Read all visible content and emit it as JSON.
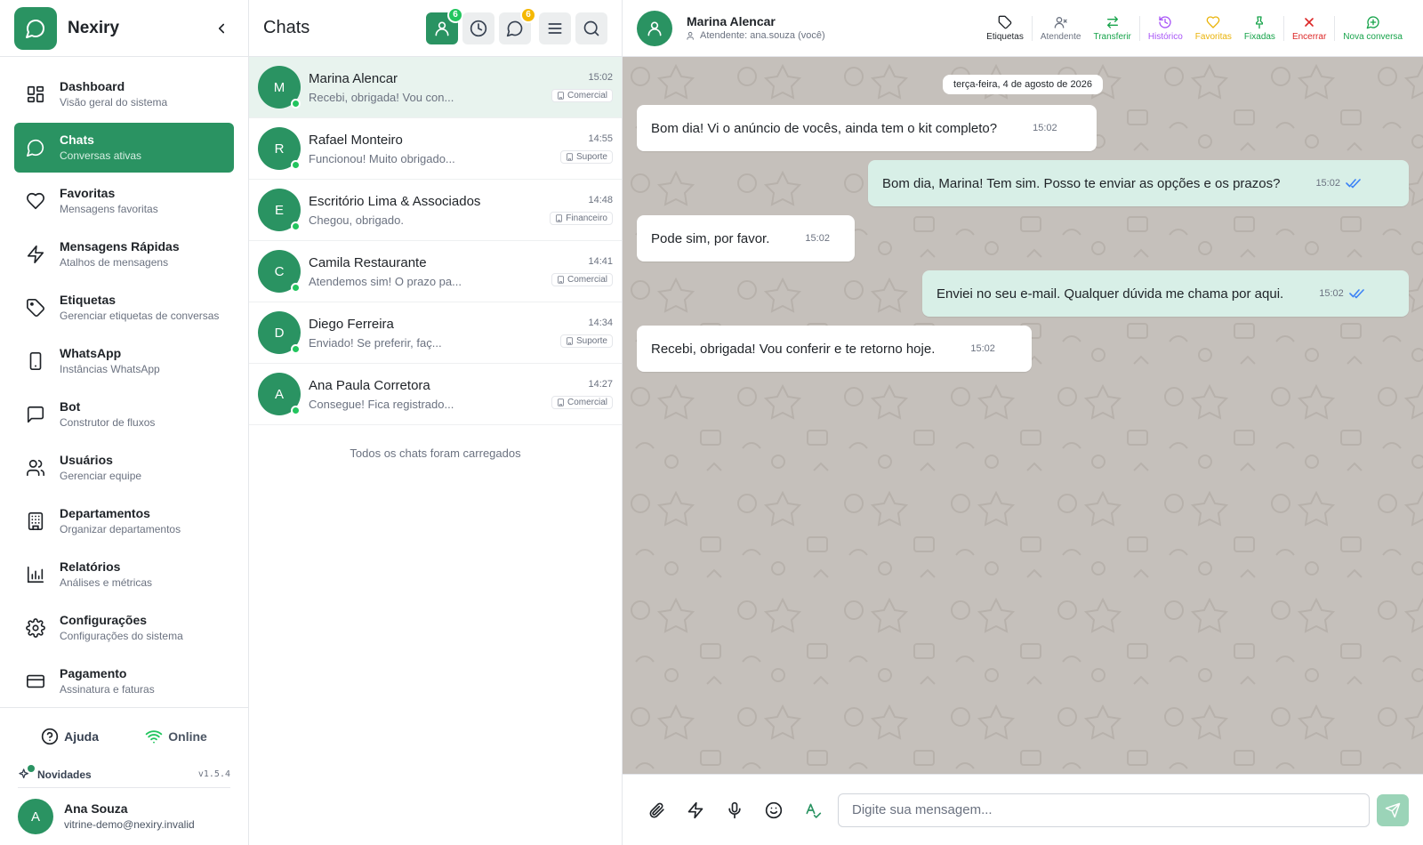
{
  "app": {
    "name": "Nexiry"
  },
  "sidebar": {
    "items": [
      {
        "label": "Dashboard",
        "sub": "Visão geral do sistema",
        "icon": "dashboard-icon"
      },
      {
        "label": "Chats",
        "sub": "Conversas ativas",
        "icon": "chat-icon"
      },
      {
        "label": "Favoritas",
        "sub": "Mensagens favoritas",
        "icon": "heart-icon"
      },
      {
        "label": "Mensagens Rápidas",
        "sub": "Atalhos de mensagens",
        "icon": "bolt-icon"
      },
      {
        "label": "Etiquetas",
        "sub": "Gerenciar etiquetas de conversas",
        "icon": "tag-icon"
      },
      {
        "label": "WhatsApp",
        "sub": "Instâncias WhatsApp",
        "icon": "phone-icon"
      },
      {
        "label": "Bot",
        "sub": "Construtor de fluxos",
        "icon": "bot-icon"
      },
      {
        "label": "Usuários",
        "sub": "Gerenciar equipe",
        "icon": "users-icon"
      },
      {
        "label": "Departamentos",
        "sub": "Organizar departamentos",
        "icon": "building-icon"
      },
      {
        "label": "Relatórios",
        "sub": "Análises e métricas",
        "icon": "chart-icon"
      },
      {
        "label": "Configurações",
        "sub": "Configurações do sistema",
        "icon": "gear-icon"
      },
      {
        "label": "Pagamento",
        "sub": "Assinatura e faturas",
        "icon": "card-icon"
      }
    ],
    "help_label": "Ajuda",
    "online_label": "Online",
    "news_label": "Novidades",
    "version": "v1.5.4",
    "user": {
      "initial": "A",
      "name": "Ana Souza",
      "email": "vitrine-demo@nexiry.invalid"
    }
  },
  "chatlist": {
    "title": "Chats",
    "badges": {
      "mine": "6",
      "waiting": "6"
    },
    "chats": [
      {
        "initial": "M",
        "name": "Marina Alencar",
        "preview": "Recebi, obrigada! Vou con...",
        "time": "15:02",
        "tag": "Comercial"
      },
      {
        "initial": "R",
        "name": "Rafael Monteiro",
        "preview": "Funcionou! Muito obrigado...",
        "time": "14:55",
        "tag": "Suporte"
      },
      {
        "initial": "E",
        "name": "Escritório Lima & Associados",
        "preview": "Chegou, obrigado.",
        "time": "14:48",
        "tag": "Financeiro"
      },
      {
        "initial": "C",
        "name": "Camila Restaurante",
        "preview": "Atendemos sim! O prazo pa...",
        "time": "14:41",
        "tag": "Comercial"
      },
      {
        "initial": "D",
        "name": "Diego Ferreira",
        "preview": "Enviado! Se preferir, faç...",
        "time": "14:34",
        "tag": "Suporte"
      },
      {
        "initial": "A",
        "name": "Ana Paula Corretora",
        "preview": "Consegue! Fica registrado...",
        "time": "14:27",
        "tag": "Comercial"
      }
    ],
    "end_text": "Todos os chats foram carregados"
  },
  "conversation": {
    "contact": "Marina Alencar",
    "agent": "Atendente: ana.souza (você)",
    "toolbar": {
      "etiquetas": "Etiquetas",
      "atendente": "Atendente",
      "transferir": "Transferir",
      "historico": "Histórico",
      "favoritas": "Favoritas",
      "fixadas": "Fixadas",
      "encerrar": "Encerrar",
      "nova": "Nova conversa"
    },
    "date": "terça-feira, 4 de agosto de 2026",
    "messages": [
      {
        "dir": "in",
        "text": "Bom dia! Vi o anúncio de vocês, ainda tem o kit completo?",
        "time": "15:02"
      },
      {
        "dir": "out",
        "text": "Bom dia, Marina! Tem sim. Posso te enviar as opções e os prazos?",
        "time": "15:02"
      },
      {
        "dir": "in",
        "text": "Pode sim, por favor.",
        "time": "15:02"
      },
      {
        "dir": "out",
        "text": "Enviei no seu e-mail. Qualquer dúvida me chama por aqui.",
        "time": "15:02"
      },
      {
        "dir": "in",
        "text": "Recebi, obrigada! Vou conferir e te retorno hoje.",
        "time": "15:02"
      }
    ],
    "composer_placeholder": "Digite sua mensagem..."
  },
  "colors": {
    "brand": "#2a9362",
    "tool_default": "#4b5563",
    "tool_transfer": "#16a34a",
    "tool_history": "#a855f7",
    "tool_favorites": "#eab308",
    "tool_pinned": "#16a34a",
    "tool_close": "#dc2626",
    "tool_new": "#16a34a"
  }
}
